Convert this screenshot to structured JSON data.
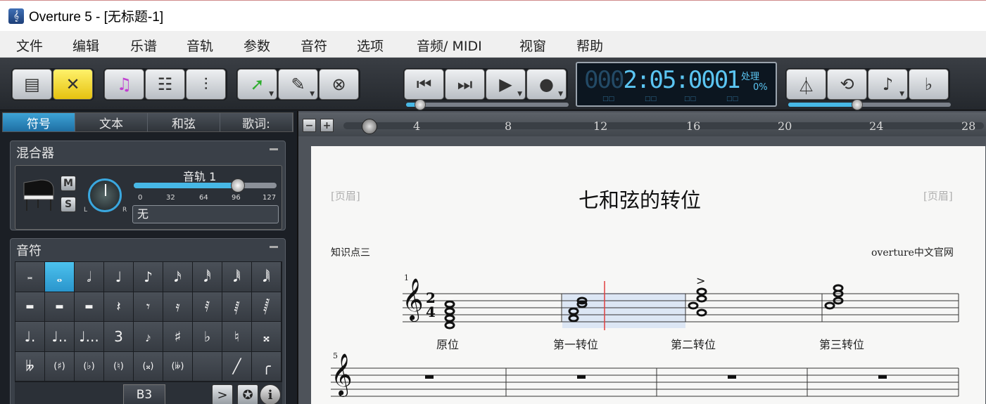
{
  "window": {
    "title": "Overture 5 - [无标题-1]",
    "icon": "treble-clef-icon"
  },
  "menu": [
    "文件",
    "编辑",
    "乐谱",
    "音轨",
    "参数",
    "音符",
    "选项",
    "音频/ MIDI",
    "视窗",
    "帮助"
  ],
  "toolbar": {
    "counter": {
      "time_dim": "000",
      "time_main": "2:05:000",
      "measure": "1",
      "processing": "处理",
      "percent": "0%"
    }
  },
  "left_tabs": [
    {
      "label": "符号",
      "active": true
    },
    {
      "label": "文本",
      "active": false
    },
    {
      "label": "和弦",
      "active": false
    },
    {
      "label": "歌词:",
      "active": false
    }
  ],
  "mixer": {
    "title": "混合器",
    "mute_label": "M",
    "solo_label": "S",
    "pan_left": "L",
    "pan_right": "R",
    "track_name": "音轨 1",
    "volume": 104,
    "volume_max": 127,
    "ticks": [
      "0",
      "32",
      "64",
      "96",
      "127"
    ],
    "instrument": "无"
  },
  "notes_palette": {
    "title": "音符",
    "rows": [
      [
        "𝅜",
        "𝅝",
        "𝅗𝅥",
        "♩",
        "♪",
        "𝅘𝅥𝅯",
        "𝅘𝅥𝅰",
        "𝅘𝅥𝅱",
        "𝅘𝅥𝅲"
      ],
      [
        "▬",
        "▬",
        "▬",
        "𝄽",
        "𝄾",
        "𝄿",
        "𝅀",
        "𝅁",
        "𝅂"
      ],
      [
        "♩.",
        "♩..",
        "♩...",
        "3",
        "𝆔",
        "♯",
        "♭",
        "♮",
        "𝄪"
      ],
      [
        "𝄫",
        "(♯)",
        "(♭)",
        "(♮)",
        "(𝄪)",
        "(𝄫)",
        "",
        "╱",
        "╭"
      ]
    ],
    "pitch": "B3",
    "accent_label": ">",
    "info_label": "i"
  },
  "ruler": {
    "marks": [
      "4",
      "8",
      "12",
      "16",
      "20",
      "24",
      "28"
    ],
    "zoom_out": "−",
    "zoom_in": "+"
  },
  "score": {
    "header_left": "[页眉]",
    "header_right": "[页眉]",
    "title": "七和弦的转位",
    "subtitle_left": "知识点三",
    "subtitle_right": "overture中文官网",
    "measure_numbers": [
      "1",
      "5"
    ],
    "time_signature": {
      "top": "2",
      "bottom": "4"
    },
    "accent": ">",
    "chord_labels": [
      "原位",
      "第一转位",
      "第二转位",
      "第三转位"
    ]
  },
  "colors": {
    "accent_blue": "#47b8e6",
    "tool_yellow": "#f2d21c",
    "selection": "#dce6f4",
    "cursor": "#e04040"
  }
}
